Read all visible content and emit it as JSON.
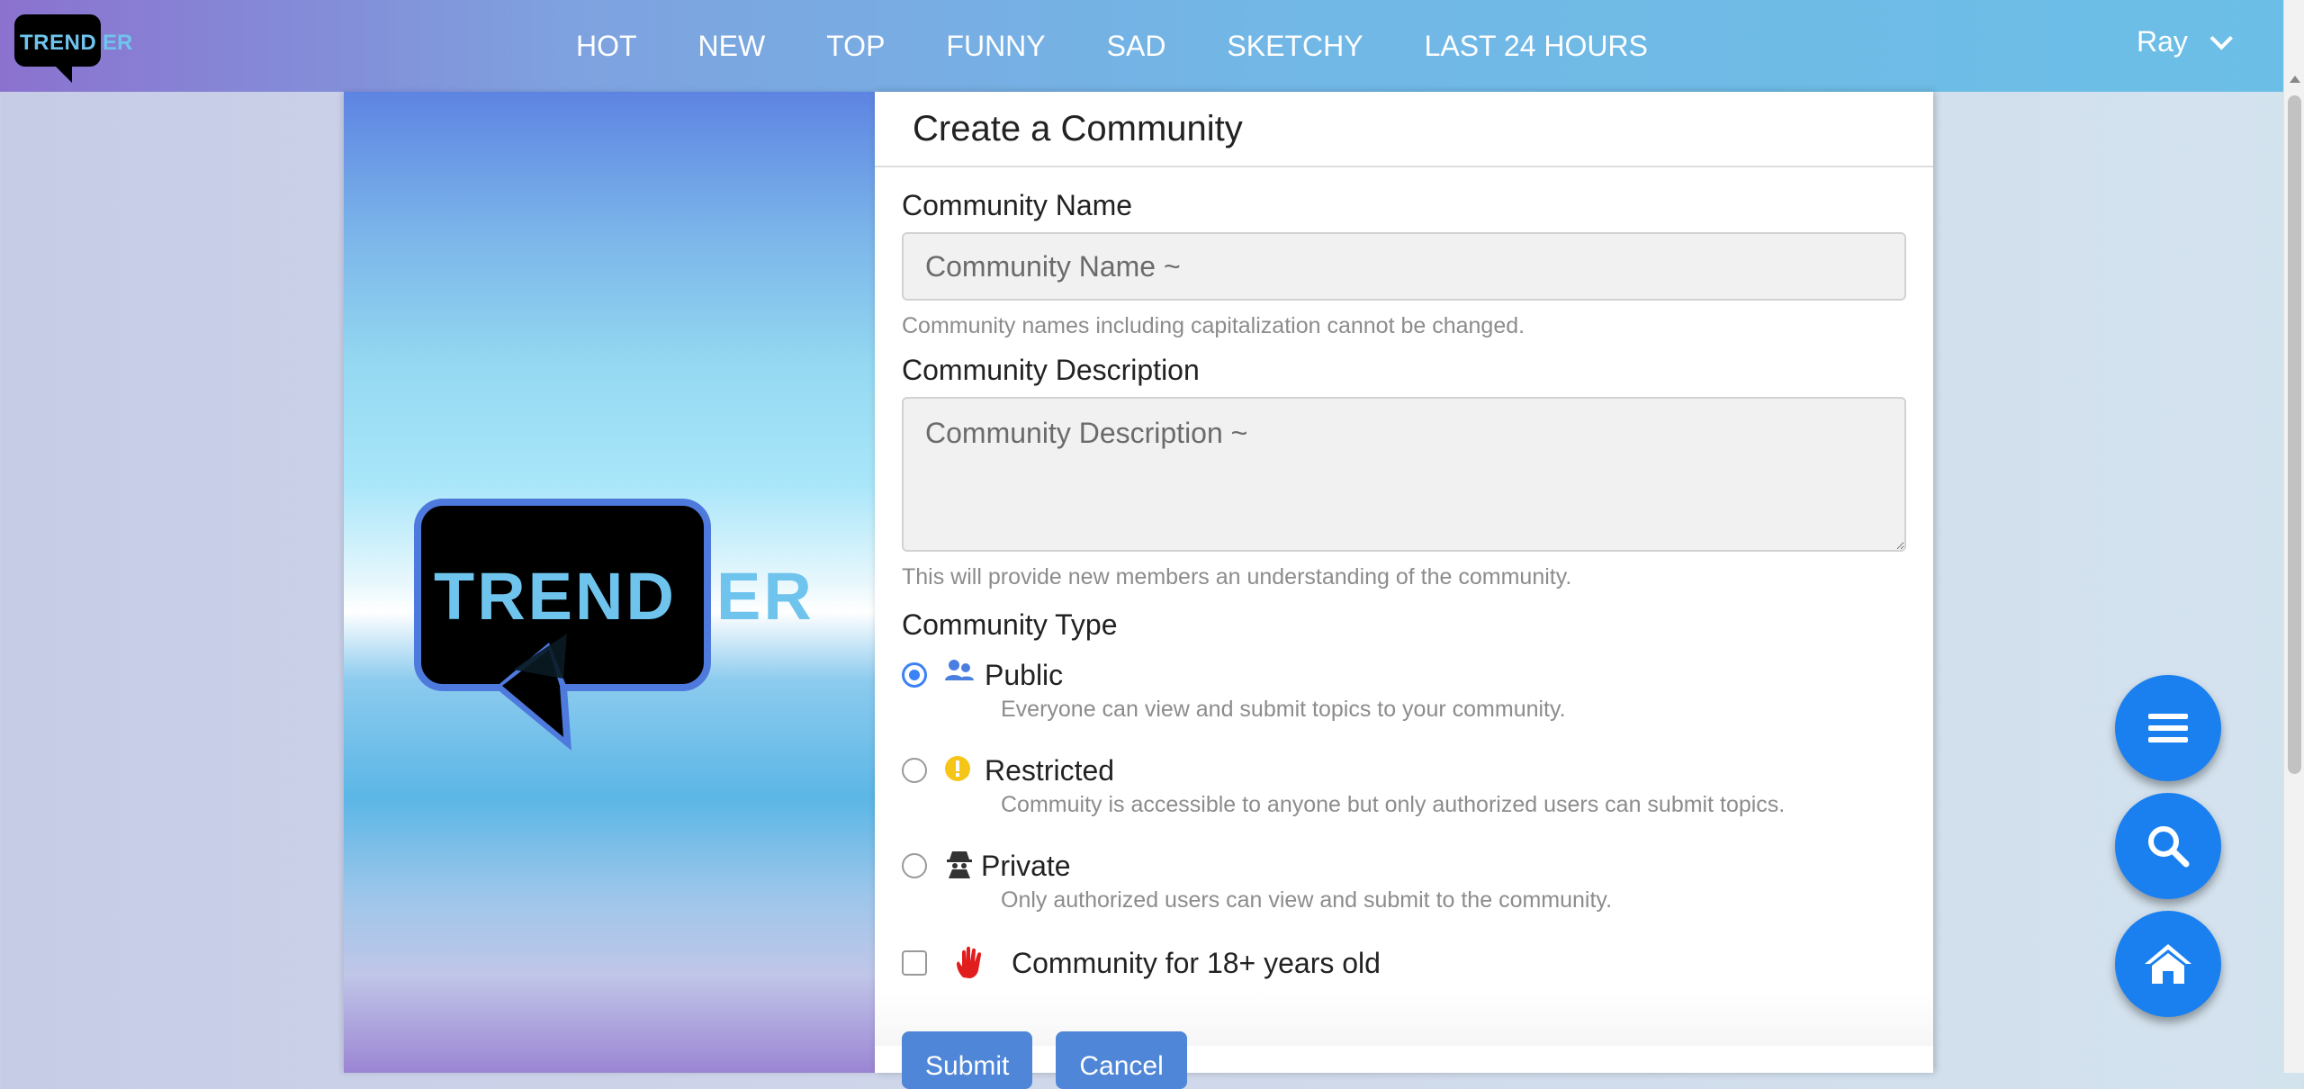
{
  "brand": {
    "logo_part1": "TREND",
    "logo_part2": "ER"
  },
  "nav": {
    "links": [
      "HOT",
      "NEW",
      "TOP",
      "FUNNY",
      "SAD",
      "SKETCHY",
      "LAST 24 HOURS"
    ],
    "user": "Ray"
  },
  "card": {
    "title": "Create a Community"
  },
  "form": {
    "name_label": "Community Name",
    "name_placeholder": "Community Name ~",
    "name_help": "Community names including capitalization cannot be changed.",
    "desc_label": "Community Description",
    "desc_placeholder": "Community Description ~",
    "desc_help": "This will provide new members an understanding of the community.",
    "type_label": "Community Type",
    "types": [
      {
        "title": "Public",
        "desc": "Everyone can view and submit topics to your community.",
        "icon": "users-icon",
        "checked": true
      },
      {
        "title": "Restricted",
        "desc": "Commuity is accessible to anyone but only authorized users can submit topics.",
        "icon": "warning-icon",
        "checked": false
      },
      {
        "title": "Private",
        "desc": "Only authorized users can view and submit to the community.",
        "icon": "spy-icon",
        "checked": false
      }
    ],
    "adult_label": "Community for 18+ years old",
    "submit_label": "Submit",
    "cancel_label": "Cancel"
  },
  "fabs": [
    "menu-icon",
    "search-icon",
    "home-icon"
  ],
  "colors": {
    "accent": "#1a80f0",
    "button": "#4f86d8",
    "logo_text": "#6fc4ee",
    "warning": "#f5c518",
    "hand": "#e11d1d"
  }
}
